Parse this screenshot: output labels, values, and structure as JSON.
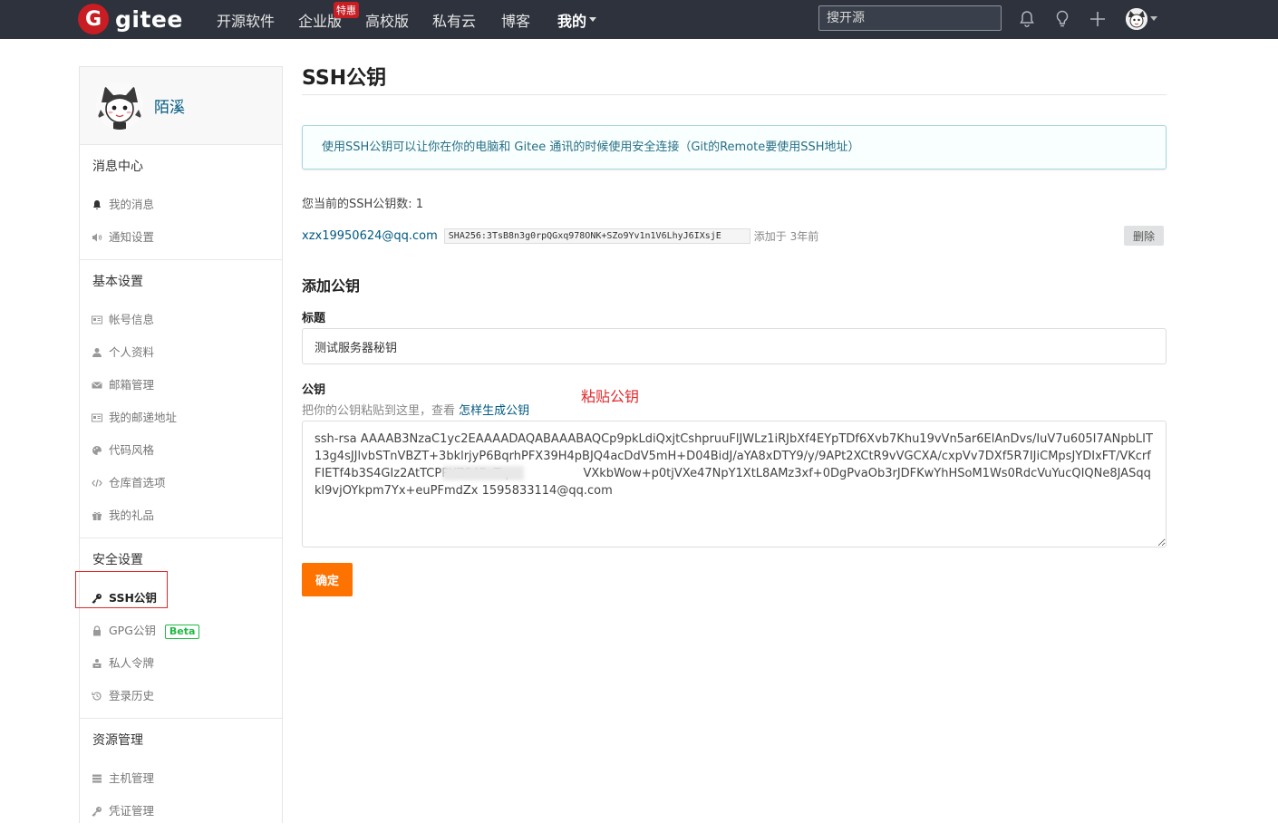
{
  "topnav": {
    "logo_mark": "G",
    "logo_text": "gitee",
    "items": [
      "开源软件",
      "企业版",
      "高校版",
      "私有云",
      "博客"
    ],
    "mine": "我的",
    "hot_badge": "特惠",
    "search_placeholder": "搜开源"
  },
  "sidebar": {
    "username": "陌溪",
    "groups": [
      {
        "title": "消息中心",
        "items": [
          {
            "label": "我的消息",
            "icon": "bell-icon"
          },
          {
            "label": "通知设置",
            "icon": "volume-icon"
          }
        ]
      },
      {
        "title": "基本设置",
        "items": [
          {
            "label": "帐号信息",
            "icon": "id-card-icon"
          },
          {
            "label": "个人资料",
            "icon": "user-icon"
          },
          {
            "label": "邮箱管理",
            "icon": "mail-icon"
          },
          {
            "label": "我的邮递地址",
            "icon": "address-card-icon"
          },
          {
            "label": "代码风格",
            "icon": "palette-icon"
          },
          {
            "label": "仓库首选项",
            "icon": "code-icon"
          },
          {
            "label": "我的礼品",
            "icon": "gift-icon"
          }
        ]
      },
      {
        "title": "安全设置",
        "items": [
          {
            "label": "SSH公钥",
            "icon": "key-icon",
            "active": true
          },
          {
            "label": "GPG公钥",
            "icon": "lock-icon",
            "badge": "Beta"
          },
          {
            "label": "私人令牌",
            "icon": "token-icon"
          },
          {
            "label": "登录历史",
            "icon": "history-icon"
          }
        ]
      },
      {
        "title": "资源管理",
        "items": [
          {
            "label": "主机管理",
            "icon": "server-icon"
          },
          {
            "label": "凭证管理",
            "icon": "key-icon"
          }
        ]
      }
    ]
  },
  "main": {
    "title": "SSH公钥",
    "info": "使用SSH公钥可以让你在你的电脑和 Gitee 通讯的时候使用安全连接（Git的Remote要使用SSH地址）",
    "key_count": "您当前的SSH公钥数: 1",
    "existing_key": {
      "email": "xzx19950624@qq.com",
      "fingerprint": "SHA256:3TsB8n3g0rpQGxq978ONK+SZo9Yv1n1V6LhyJ6IXsjE",
      "added": "添加于 3年前",
      "delete_label": "删除"
    },
    "add_title": "添加公钥",
    "label_title": "标题",
    "title_value": "测试服务器秘钥",
    "label_key": "公钥",
    "hint_text": "把你的公钥粘贴到这里，查看 ",
    "hint_link": "怎样生成公钥",
    "paste_note": "粘贴公钥",
    "key_value": "ssh-rsa AAAAB3NzaC1yc2EAAAADAQABAAABAQCp9pkLdiQxjtCshpruuFlJWLz1iRJbXf4EYpTDf6Xvb7Khu19vVn5ar6ElAnDvs/IuV7u605I7ANpbLIT13g4sJJlvbSTnVBZT+3bklrjyP6BqrhPFX39H4pBJQ4acDdV5mH+D04BidJ/aYA8xDTY9/y/9APt2XCtR9vVGCXA/cxpVv7DXf5R7IJiCMpsJYDIxFT/VKcrfFIETf4b3S4GIz2AtTCPRYZS4PnTq                    VXkbWow+p0tjVXe47NpY1XtL8AMz3xf+0DgPvaOb3rJDFKwYhHSoM1Ws0RdcVuYucQIQNe8JASqqkl9vjOYkpm7Yx+euPFmdZx 1595833114@qq.com",
    "submit_label": "确定"
  }
}
